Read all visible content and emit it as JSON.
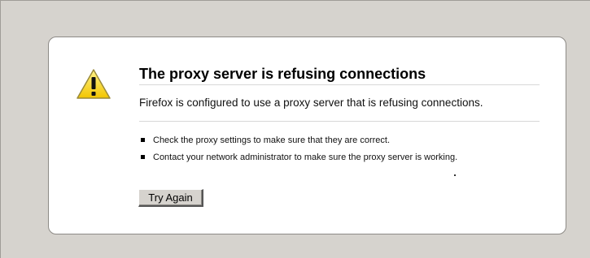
{
  "error": {
    "title": "The proxy server is refusing connections",
    "description": "Firefox is configured to use a proxy server that is refusing connections.",
    "suggestions": [
      "Check the proxy settings to make sure that they are correct.",
      "Contact your network administrator to make sure the proxy server is working."
    ],
    "icon": "warning-icon",
    "icon_color": "#f5d20a"
  },
  "actions": {
    "try_again_label": "Try Again"
  },
  "colors": {
    "page_background": "#d6d3ce",
    "box_background": "#ffffff",
    "box_border": "#8d8a86"
  }
}
